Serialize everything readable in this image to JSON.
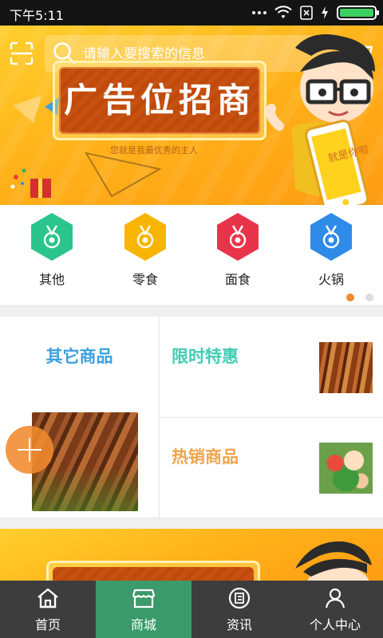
{
  "status_bar": {
    "time": "下午5:11"
  },
  "search": {
    "placeholder": "请输入要搜索的信息"
  },
  "banner": {
    "title": "广告位招商",
    "slogan": "您就是我最优秀的主人",
    "phone_text": "就是你啦"
  },
  "categories": [
    {
      "label": "其他",
      "color": "#2bc48c",
      "icon": "medal-icon"
    },
    {
      "label": "零食",
      "color": "#f7b500",
      "icon": "medal-icon"
    },
    {
      "label": "面食",
      "color": "#e8344a",
      "icon": "medal-icon"
    },
    {
      "label": "火锅",
      "color": "#2f8be8",
      "icon": "medal-icon"
    }
  ],
  "pager": {
    "current": 1,
    "total": 2
  },
  "products": {
    "left_title": "其它商品",
    "right_top_title": "限时特惠",
    "right_bottom_title": "热销商品"
  },
  "tabbar": [
    {
      "label": "首页",
      "icon": "home-icon",
      "active": false
    },
    {
      "label": "商城",
      "icon": "shop-icon",
      "active": true
    },
    {
      "label": "资讯",
      "icon": "news-icon",
      "active": false
    },
    {
      "label": "个人中心",
      "icon": "user-icon",
      "active": false
    }
  ],
  "colors": {
    "banner": "#ffb31a",
    "active_tab": "#3a9a6a",
    "tabbar": "#3d3d3d",
    "accent_orange": "#f08a2e"
  }
}
